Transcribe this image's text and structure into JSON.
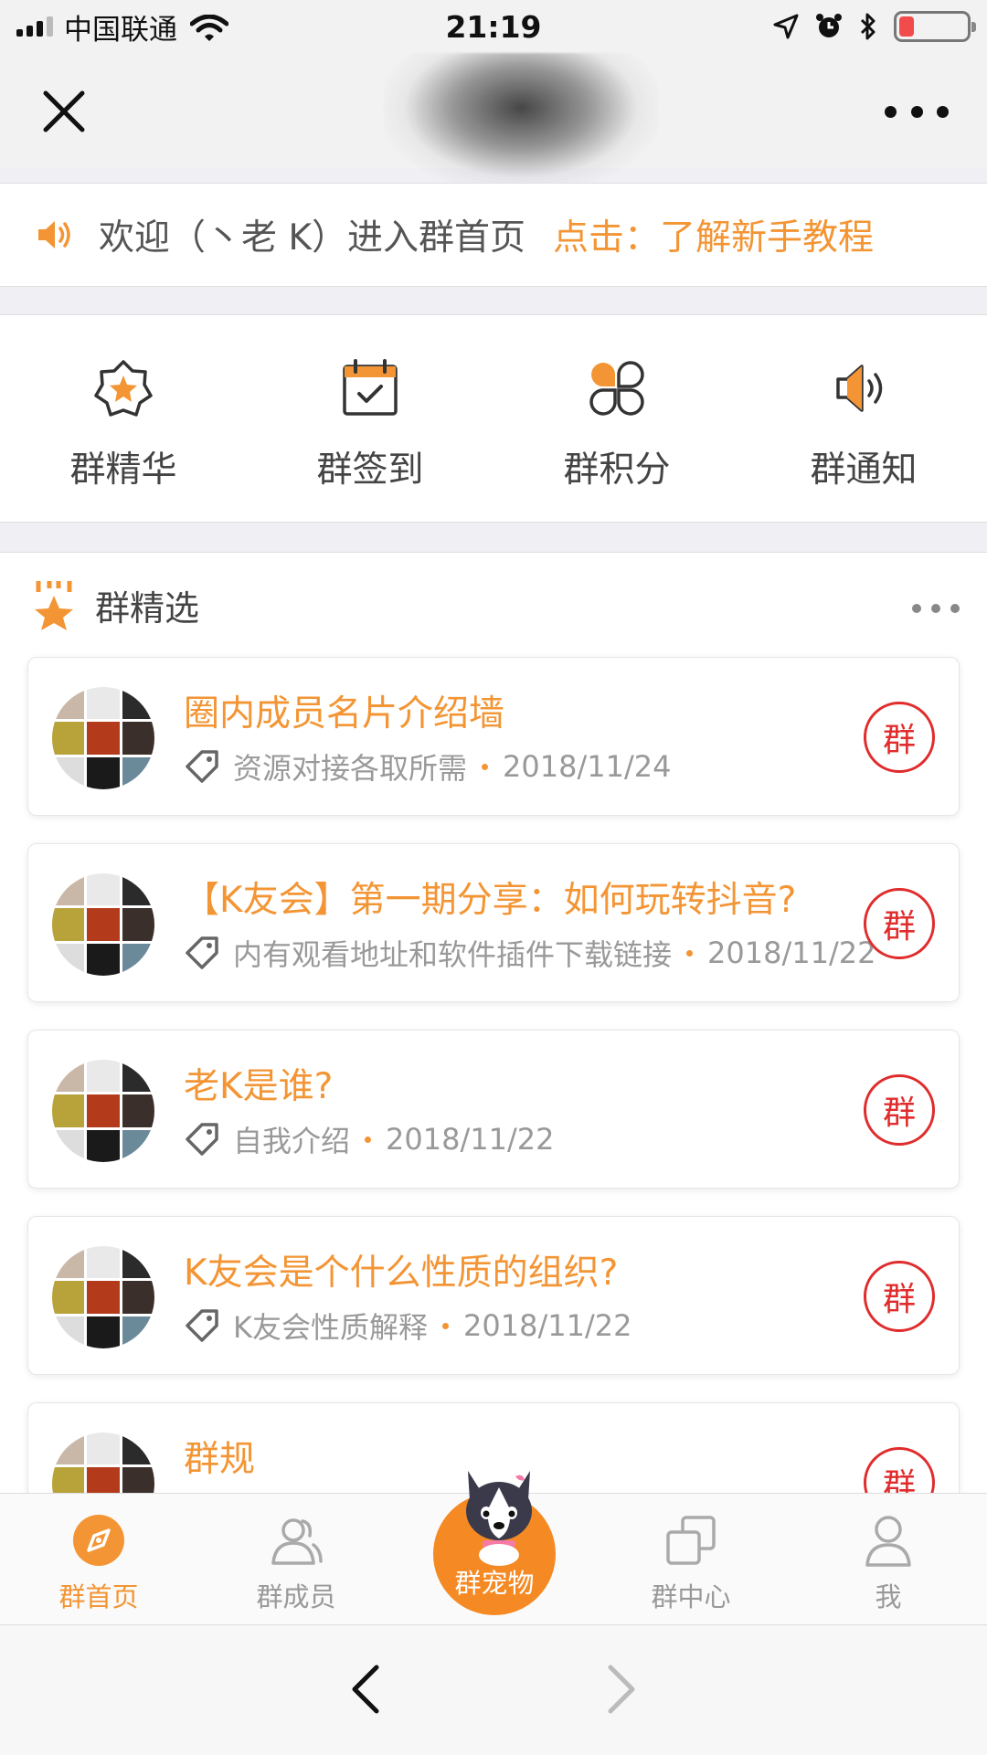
{
  "status_bar": {
    "carrier": "中国联通",
    "time": "21:19"
  },
  "welcome": {
    "text": "欢迎（丶老 K）进入群首页",
    "link": "点击：了解新手教程"
  },
  "quick_menu": [
    {
      "label": "群精华",
      "icon": "star-badge-icon"
    },
    {
      "label": "群签到",
      "icon": "calendar-check-icon"
    },
    {
      "label": "群积分",
      "icon": "four-petal-icon"
    },
    {
      "label": "群通知",
      "icon": "speaker-icon"
    }
  ],
  "featured": {
    "title": "群精选",
    "items": [
      {
        "title": "圈内成员名片介绍墙",
        "tag": "资源对接各取所需",
        "date": "2018/11/24",
        "stamp": "群"
      },
      {
        "title": "【K友会】第一期分享：如何玩转抖音?",
        "tag": "内有观看地址和软件插件下载链接",
        "date": "2018/11/22",
        "stamp": "群"
      },
      {
        "title": "老K是谁?",
        "tag": "自我介绍",
        "date": "2018/11/22",
        "stamp": "群"
      },
      {
        "title": "K友会是个什么性质的组织?",
        "tag": "K友会性质解释",
        "date": "2018/11/22",
        "stamp": "群"
      },
      {
        "title": "群规",
        "tag": "",
        "date": "",
        "stamp": "群"
      }
    ]
  },
  "tabs": [
    {
      "label": "群首页",
      "icon": "compass-icon",
      "active": true
    },
    {
      "label": "群成员",
      "icon": "members-icon",
      "active": false
    },
    {
      "label": "群宠物",
      "icon": "husky-pet-icon",
      "active": false
    },
    {
      "label": "群中心",
      "icon": "center-squares-icon",
      "active": false
    },
    {
      "label": "我",
      "icon": "person-icon",
      "active": false
    }
  ],
  "colors": {
    "accent": "#f39534",
    "stamp": "#e02c2c"
  }
}
